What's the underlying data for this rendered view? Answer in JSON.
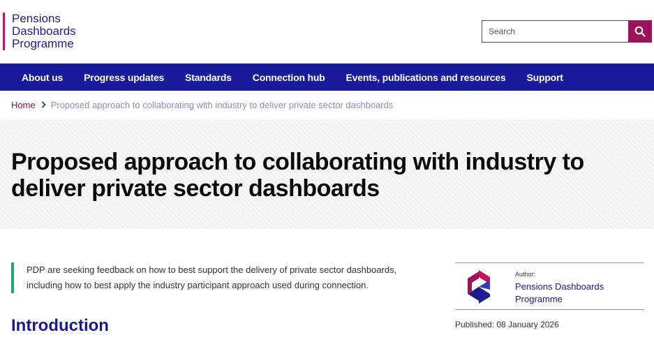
{
  "header": {
    "logo_lines": [
      "Pensions",
      "Dashboards",
      "Programme"
    ],
    "search_placeholder": "Search"
  },
  "nav": {
    "items": [
      {
        "label": "About us"
      },
      {
        "label": "Progress updates"
      },
      {
        "label": "Standards"
      },
      {
        "label": "Connection hub"
      },
      {
        "label": "Events, publications and resources"
      },
      {
        "label": "Support"
      }
    ]
  },
  "breadcrumb": {
    "home": "Home",
    "current": "Proposed approach to collaborating with industry to deliver private sector dashboards"
  },
  "page": {
    "title": "Proposed approach to collaborating with industry to deliver private sector dashboards",
    "summary": "PDP are seeking feedback on how to best support the delivery of private sector dashboards, including how to best apply the industry participant approach used during connection.",
    "intro_heading": "Introduction"
  },
  "author": {
    "label": "Author:",
    "name": "Pensions Dashboards Programme"
  },
  "published": "Published: 08 January 2026",
  "icons": {
    "search": "search-icon",
    "breadcrumb_separator": "chevron-right-icon",
    "author_logo": "pdp-logo-icon"
  },
  "colors": {
    "nav_bg": "#1a1a9c",
    "accent_magenta": "#9b1459",
    "summary_border": "#12a87a",
    "heading_blue": "#1a1a8c"
  }
}
